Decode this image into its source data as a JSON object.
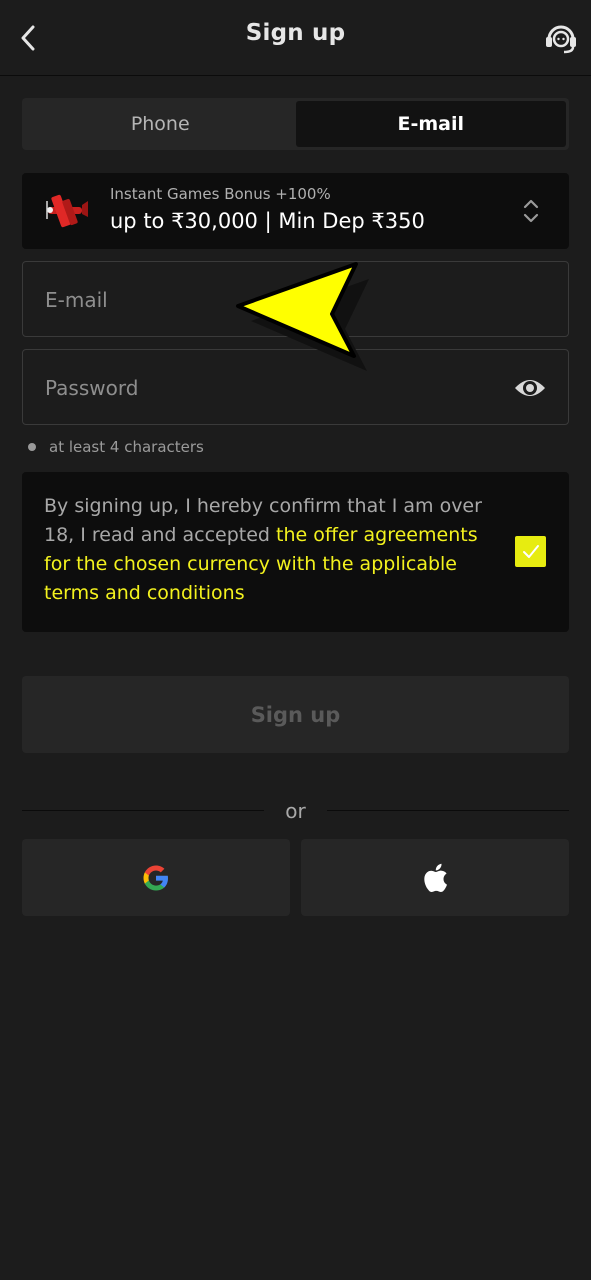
{
  "header": {
    "title": "Sign up",
    "back_icon": "chevron-left-icon",
    "support_icon": "headset-icon"
  },
  "tabs": [
    {
      "label": "Phone",
      "active": false
    },
    {
      "label": "E-mail",
      "active": true
    }
  ],
  "bonus": {
    "subtitle": "Instant Games Bonus +100%",
    "title": "up to ₹30,000 | Min Dep ₹350",
    "icon": "plane-icon"
  },
  "form": {
    "email_placeholder": "E-mail",
    "password_placeholder": "Password",
    "password_hint": "at least 4 characters"
  },
  "terms": {
    "text_plain": "By signing up, I hereby confirm that I am over 18, I read and accepted ",
    "text_link": "the offer agreements for the chosen currency with the applicable terms and conditions",
    "checked": true
  },
  "submit": {
    "label": "Sign up"
  },
  "divider": {
    "label": "or"
  },
  "social": [
    {
      "provider": "google",
      "icon": "google-icon"
    },
    {
      "provider": "apple",
      "icon": "apple-icon"
    }
  ],
  "colors": {
    "background": "#1c1c1c",
    "accent": "#e7ec10",
    "link": "#f3f21e",
    "annotation_arrow": "#ffff00"
  }
}
